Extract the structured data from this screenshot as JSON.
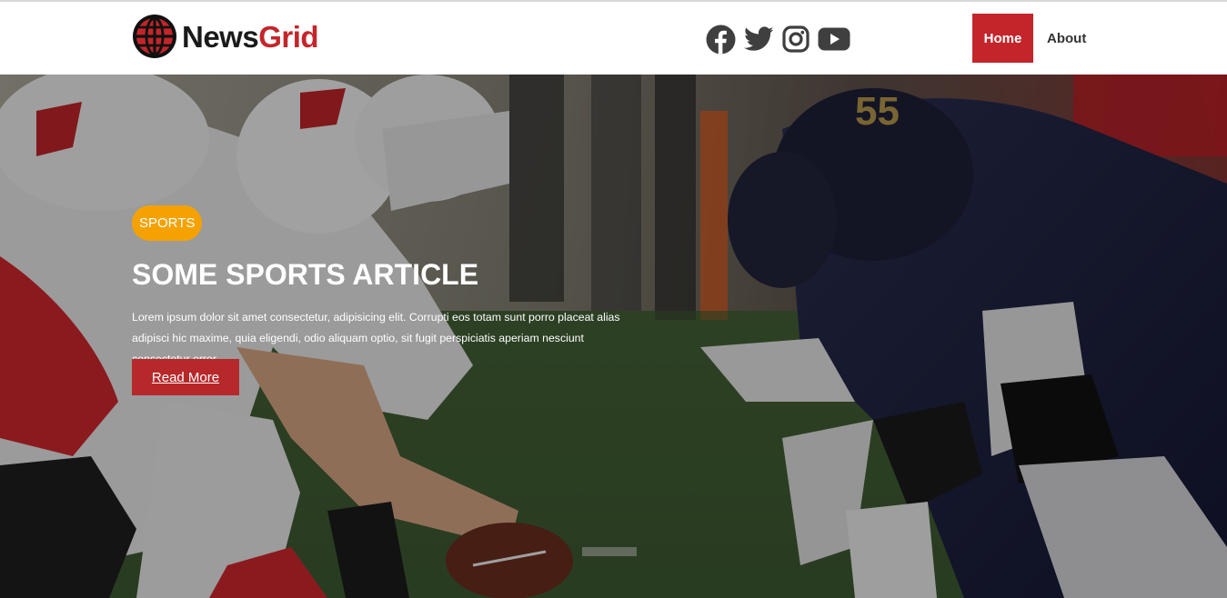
{
  "brand": {
    "name_part1": "News",
    "name_part2": "Grid",
    "dark_color": "#1a1a1a",
    "accent_color": "#c4252a",
    "logo_icon": "globe-icon"
  },
  "social": [
    {
      "name": "facebook",
      "icon": "facebook-icon",
      "label": "Facebook"
    },
    {
      "name": "twitter",
      "icon": "twitter-icon",
      "label": "Twitter"
    },
    {
      "name": "instagram",
      "icon": "instagram-icon",
      "label": "Instagram"
    },
    {
      "name": "youtube",
      "icon": "youtube-icon",
      "label": "YouTube"
    }
  ],
  "nav": {
    "home": "Home",
    "about": "About",
    "active": "Home",
    "active_color": "#c4252a"
  },
  "hero": {
    "background": "photo of American football players lined up at the line of scrimmage",
    "category": "SPORTS",
    "category_color": "#f5a200",
    "title": "SOME SPORTS ARTICLE",
    "body": "Lorem ipsum dolor sit amet consectetur, adipisicing elit. Corrupti eos totam sunt porro placeat alias adipisci hic maxime, quia eligendi, odio aliquam optio, sit fugit perspiciatis aperiam nesciunt consectetur error.",
    "cta": "Read More",
    "cta_color": "#b6282a"
  }
}
